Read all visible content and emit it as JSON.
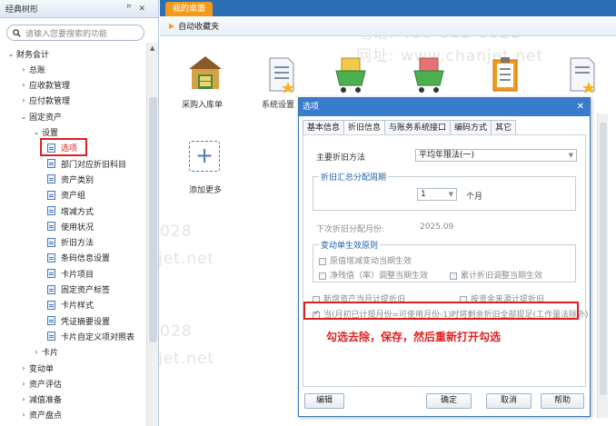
{
  "left_panel": {
    "title": "经典树形",
    "pin": "ꟸ",
    "close": "✕",
    "search_placeholder": "请输入您要搜索的功能"
  },
  "tree": [
    {
      "label": "财务会计",
      "arrow": "⌄",
      "type": "folder"
    },
    {
      "label": "总账",
      "arrow": "›",
      "type": "folder"
    },
    {
      "label": "应收款管理",
      "arrow": "›",
      "type": "folder"
    },
    {
      "label": "应付款管理",
      "arrow": "›",
      "type": "folder"
    },
    {
      "label": "固定资产",
      "arrow": "⌄",
      "type": "folder"
    },
    {
      "label": "设置",
      "arrow": "⌄",
      "type": "folder"
    },
    {
      "label": "选项",
      "type": "leaf",
      "selected": true
    },
    {
      "label": "部门对应折旧科目",
      "type": "leaf"
    },
    {
      "label": "资产类别",
      "type": "leaf"
    },
    {
      "label": "资产组",
      "type": "leaf"
    },
    {
      "label": "增减方式",
      "type": "leaf"
    },
    {
      "label": "使用状况",
      "type": "leaf"
    },
    {
      "label": "折旧方法",
      "type": "leaf"
    },
    {
      "label": "条码信息设置",
      "type": "leaf"
    },
    {
      "label": "卡片项目",
      "type": "leaf"
    },
    {
      "label": "固定资产标签",
      "type": "leaf"
    },
    {
      "label": "卡片样式",
      "type": "leaf"
    },
    {
      "label": "凭证摘要设置",
      "type": "leaf"
    },
    {
      "label": "卡片自定义项对照表",
      "type": "leaf"
    },
    {
      "label": "卡片",
      "arrow": "›",
      "type": "folder"
    },
    {
      "label": "变动单",
      "arrow": "›",
      "type": "folder"
    },
    {
      "label": "资产评估",
      "arrow": "›",
      "type": "folder"
    },
    {
      "label": "减值准备",
      "arrow": "›",
      "type": "folder"
    },
    {
      "label": "资产盘点",
      "arrow": "›",
      "type": "folder"
    }
  ],
  "tabbar": {
    "active_tab": "我的桌面"
  },
  "favorites": {
    "label": "自动收藏夹"
  },
  "desk_apps": [
    {
      "label": "采购入库单",
      "icon": "warehouse-icon"
    },
    {
      "label": "系统设置",
      "icon": "document-icon"
    },
    {
      "label": "",
      "icon": "cart-icon"
    },
    {
      "label": "",
      "icon": "cart-icon"
    },
    {
      "label": "",
      "icon": "clipboard-icon"
    },
    {
      "label": "",
      "icon": "document-star-icon"
    }
  ],
  "add_more": {
    "label": "添加更多",
    "symbol": "+"
  },
  "watermark": {
    "phone": "电话: 400-665-0028",
    "site": "网址: www.chanjet.net"
  },
  "dialog": {
    "title": "选项",
    "close": "✕",
    "tabs": [
      "基本信息",
      "折旧信息",
      "与账务系统接口",
      "编码方式",
      "其它"
    ],
    "active_tab": "折旧信息",
    "main_method_label": "主要折旧方法",
    "main_method_value": "平均年限法(一)",
    "period_group_label": "折旧汇总分配周期",
    "period_value": "1",
    "period_unit": "个月",
    "next_alloc_label": "下次折旧分配月份:",
    "next_alloc_value": "2025.09",
    "effect_group_label": "变动单生效原则",
    "effect_items": [
      "原值增减变动当期生效",
      "净残值（率）调整当期生效",
      "累计折旧调整当期生效"
    ],
    "opt_new_asset": "新增资产当月计提折旧",
    "opt_by_source": "按资金来源计提折旧",
    "opt_last_month": "当(月初已计提月份=可使用月份-1)时将剩余折旧全部提足(工作量法除外)",
    "annotation": "勾选去除，保存，然后重新打开勾选",
    "btn_edit": "编辑",
    "btn_ok": "确定",
    "btn_cancel": "取消",
    "btn_help": "帮助"
  },
  "colors": {
    "tabbar": "#2d6fb5",
    "active_tab": "#f39a1a",
    "dialog_title": "#3a7ccc",
    "highlight": "#e02020"
  }
}
